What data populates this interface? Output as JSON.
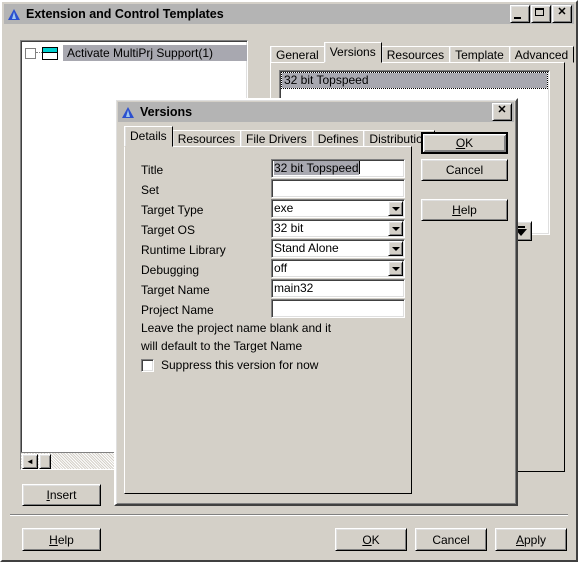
{
  "window": {
    "title": "Extension and Control Templates",
    "icon": "app-triangle-icon",
    "controls": {
      "minimize": "_",
      "maximize": "□",
      "close": "✕"
    }
  },
  "tree": {
    "items": [
      {
        "label": "Activate MultiPrj Support(1)",
        "checked": false,
        "selected": true
      }
    ],
    "hscroll": {
      "left_arrow": "◄"
    }
  },
  "main_tabs": {
    "items": [
      "General",
      "Versions",
      "Resources",
      "Template",
      "Advanced"
    ],
    "active": "Versions"
  },
  "version_list": {
    "items": [
      "32 bit Topspeed"
    ],
    "selected": "32 bit Topspeed"
  },
  "move_down_button": {
    "icon": "move-down-icon"
  },
  "left_buttons": {
    "insert": "Insert"
  },
  "bottom_buttons": {
    "help": "Help",
    "ok": "OK",
    "cancel": "Cancel",
    "apply": "Apply"
  },
  "versions_dialog": {
    "title": "Versions",
    "icon": "app-triangle-icon",
    "close": "✕",
    "tabs": {
      "items": [
        "Details",
        "Resources",
        "File Drivers",
        "Defines",
        "Distribution"
      ],
      "active": "Details"
    },
    "fields": {
      "title": {
        "label": "Title",
        "value": "32 bit Topspeed",
        "selected": true
      },
      "set": {
        "label": "Set",
        "value": ""
      },
      "target_type": {
        "label": "Target Type",
        "value": "exe"
      },
      "target_os": {
        "label": "Target OS",
        "value": "32 bit"
      },
      "runtime_library": {
        "label": "Runtime Library",
        "value": "Stand Alone"
      },
      "debugging": {
        "label": "Debugging",
        "value": "off"
      },
      "target_name": {
        "label": "Target Name",
        "value": "main32"
      },
      "project_name": {
        "label": "Project Name",
        "value": ""
      }
    },
    "hint_line1": "Leave the project name blank and it",
    "hint_line2": "will default to the Target Name",
    "suppress": {
      "label": "Suppress this version for now",
      "checked": false
    },
    "buttons": {
      "ok": "OK",
      "cancel": "Cancel",
      "help": "Help"
    }
  },
  "colors": {
    "face": "#d4d0c8",
    "titlebar": "#b4b4b4",
    "selection": "#a8a8b0",
    "icon_blue": "#2b4fcf",
    "icon_cyan": "#00d0d0"
  }
}
